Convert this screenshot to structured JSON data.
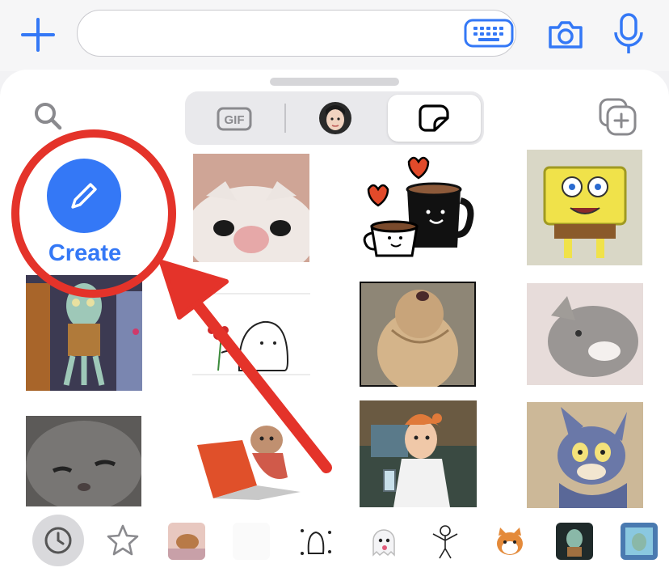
{
  "colors": {
    "accent": "#3478f6",
    "annotation_red": "#e4332a",
    "sheet_bg": "#ffffff",
    "segment_bg": "#e9e9ec"
  },
  "top_bar": {
    "plus_icon": "plus-icon",
    "message_input": {
      "value": "",
      "placeholder": ""
    },
    "keyboard_icon": "keyboard-icon",
    "camera_icon": "camera-icon",
    "mic_icon": "mic-icon"
  },
  "picker": {
    "search_icon": "search-icon",
    "segments": [
      {
        "label": "GIF",
        "icon": "gif-icon",
        "selected": false
      },
      {
        "label": "",
        "icon": "memoji-icon",
        "selected": false
      },
      {
        "label": "",
        "icon": "sticker-icon",
        "selected": true
      }
    ],
    "add_sticker_icon": "add-sticker-icon"
  },
  "create": {
    "label": "Create",
    "icon": "pencil-icon"
  },
  "stickers": [
    "cat-closeup-sticker",
    "coffee-mugs-sticker",
    "spongebob-sticker",
    "squidward-sticker",
    "bread-flower-sticker",
    "fluffy-cat-sticker",
    "blurry-cat-sticker",
    "grey-cat-sticker",
    "cat-laptop-sticker",
    "cartoon-woman-sticker",
    "tom-cat-sticker"
  ],
  "bottom_bar": {
    "recent_icon": "clock-icon",
    "favorites_icon": "star-icon",
    "thumbs": [
      "cat-bed-thumb",
      "blank-thumb",
      "sparkle-cat-thumb",
      "ghost-emoji-thumb",
      "stick-figure-thumb",
      "shiba-thumb",
      "squidward-dark-thumb",
      "squidward-window-thumb"
    ]
  }
}
